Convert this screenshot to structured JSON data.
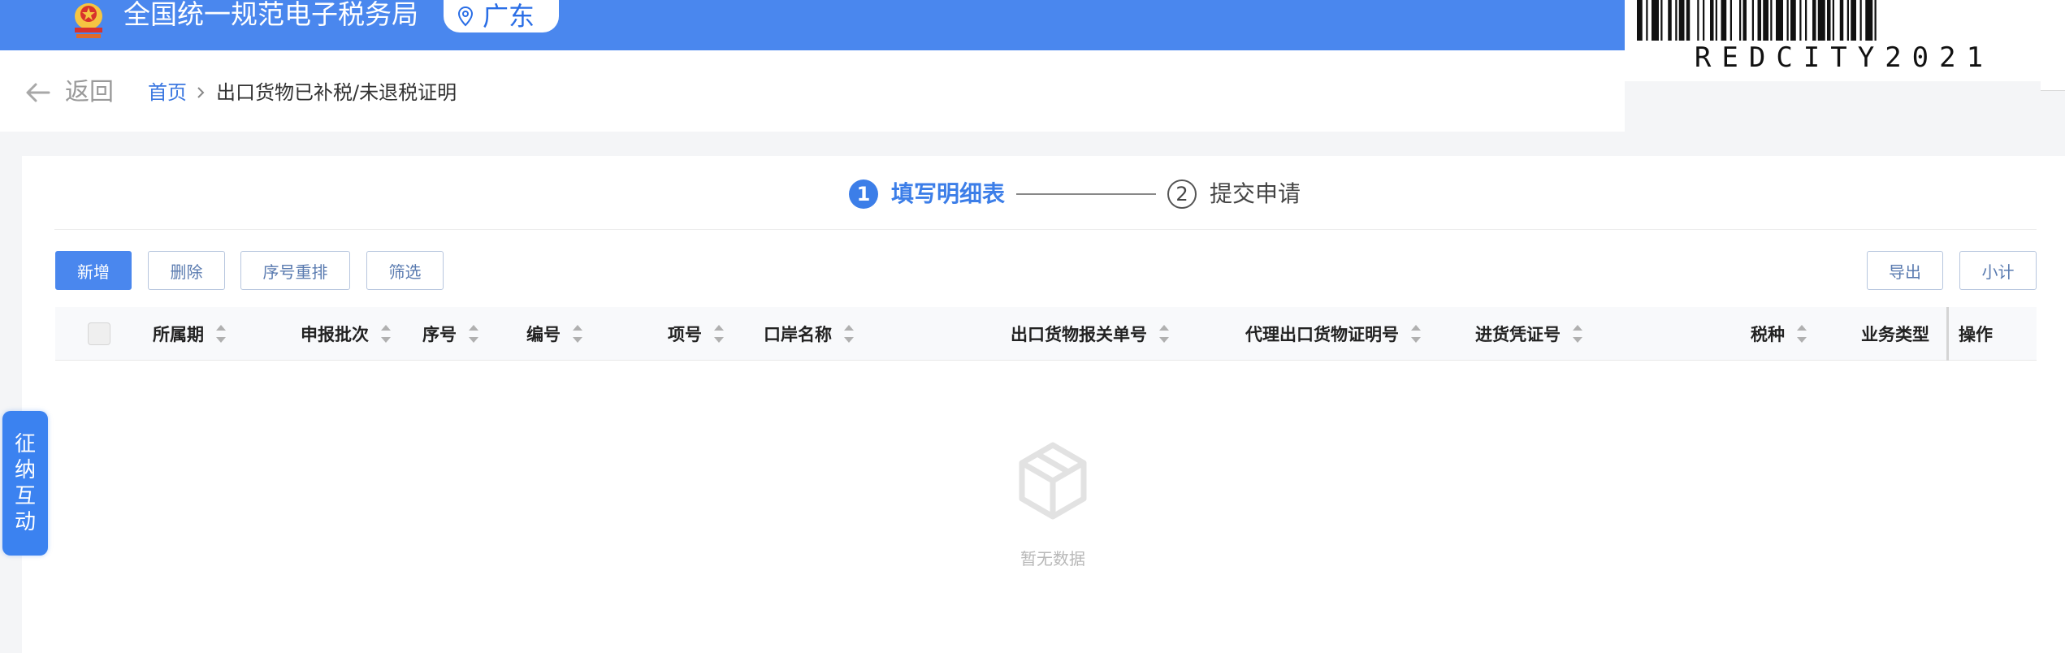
{
  "header": {
    "site_title": "全国统一规范电子税务局",
    "region": "广东",
    "emblem_icon": "national-emblem-icon",
    "location_icon": "location-pin-icon",
    "bg_color": "#4a87ee"
  },
  "barcode": {
    "text": "REDCITY2021"
  },
  "breadcrumb": {
    "back_label": "返回",
    "home": "首页",
    "current": "出口货物已补税/未退税证明"
  },
  "steps": [
    {
      "num": "1",
      "label": "填写明细表",
      "active": true
    },
    {
      "num": "2",
      "label": "提交申请",
      "active": false
    }
  ],
  "toolbar": {
    "add": "新增",
    "delete": "删除",
    "renumber": "序号重排",
    "filter": "筛选",
    "export": "导出",
    "subtotal": "小计"
  },
  "table": {
    "columns": [
      {
        "label": "所属期",
        "sortable": true
      },
      {
        "label": "申报批次",
        "sortable": true
      },
      {
        "label": "序号",
        "sortable": true
      },
      {
        "label": "编号",
        "sortable": true
      },
      {
        "label": "项号",
        "sortable": true
      },
      {
        "label": "口岸名称",
        "sortable": true
      },
      {
        "label": "出口货物报关单号",
        "sortable": true
      },
      {
        "label": "代理出口货物证明号",
        "sortable": true
      },
      {
        "label": "进货凭证号",
        "sortable": true
      },
      {
        "label": "税种",
        "sortable": true
      },
      {
        "label": "业务类型",
        "sortable": false
      },
      {
        "label": "操作",
        "sortable": false
      }
    ],
    "rows": [],
    "empty_text": "暂无数据"
  },
  "side_tab": {
    "chars": [
      "征",
      "纳",
      "互",
      "动"
    ]
  },
  "colors": {
    "primary": "#4a87ee",
    "link": "#3c78e0",
    "side_tab": "#3b82f0"
  }
}
